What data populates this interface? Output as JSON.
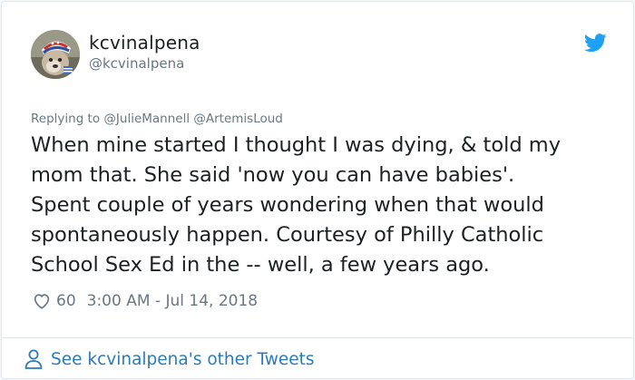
{
  "user": {
    "display_name": "kcvinalpena",
    "handle": "@kcvinalpena"
  },
  "reply": {
    "prefix": "Replying to",
    "mentions": "@JulieMannell @ArtemisLoud"
  },
  "tweet": {
    "lines": [
      "When mine started I thought I was dying, & told my",
      "mom that. She said 'now you can have babies'.",
      "Spent couple of years wondering when that would",
      "spontaneously happen. Courtesy of Philly Catholic",
      "School Sex Ed in the -- well, a few years ago."
    ]
  },
  "meta": {
    "likes": "60",
    "timestamp": "3:00 AM - Jul 14, 2018"
  },
  "footer": {
    "see_more": "See kcvinalpena's other Tweets"
  },
  "icons": {
    "like": "heart-icon",
    "brand": "twitter-bird-icon",
    "profile": "person-icon"
  },
  "colors": {
    "brand_blue": "#1da1f2",
    "link_blue": "#2b7bb9",
    "text": "#1c2022",
    "muted": "#697882",
    "border": "#e1e8ed"
  }
}
